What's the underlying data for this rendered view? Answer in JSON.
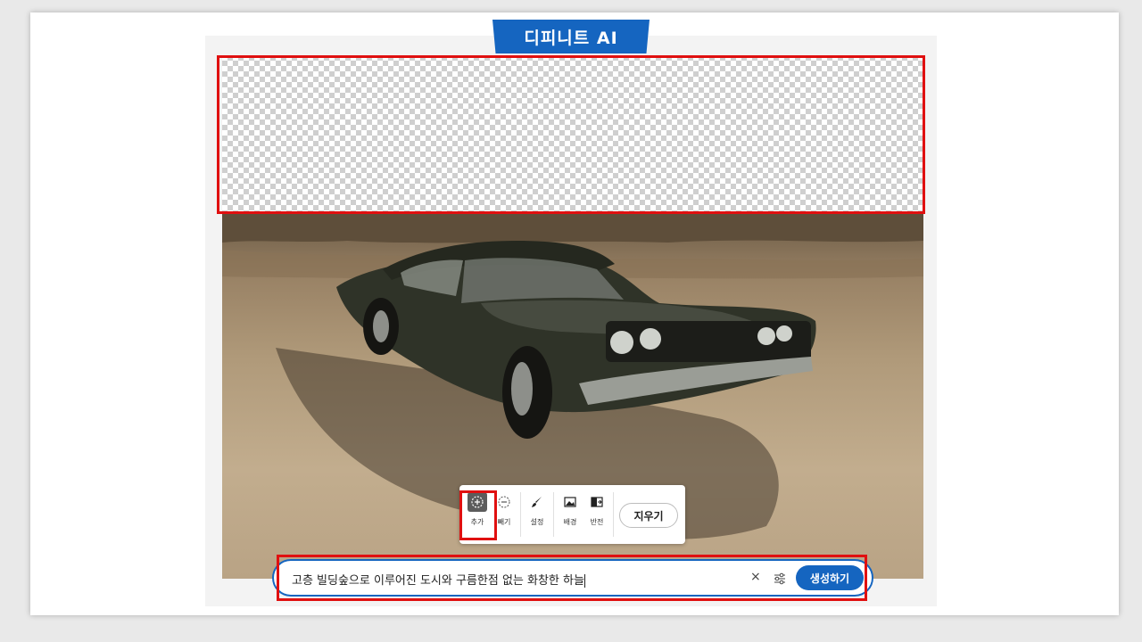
{
  "banner": {
    "title": "디피니트 AI"
  },
  "toolbar": {
    "tools": [
      {
        "label": "추가",
        "icon": "add-icon"
      },
      {
        "label": "빼기",
        "icon": "subtract-icon"
      },
      {
        "label": "설정",
        "icon": "brush-icon"
      },
      {
        "label": "배경",
        "icon": "background-icon"
      },
      {
        "label": "반전",
        "icon": "invert-icon"
      }
    ],
    "erase_label": "지우기"
  },
  "prompt": {
    "value": "고층 빌딩숲으로 이루어진 도시와 구름한점 없는 화창한 하늘",
    "clear_icon": "close-icon",
    "settings_icon": "sliders-icon",
    "generate_label": "생성하기"
  },
  "colors": {
    "brand": "#1565c0",
    "highlight": "#e01010"
  }
}
